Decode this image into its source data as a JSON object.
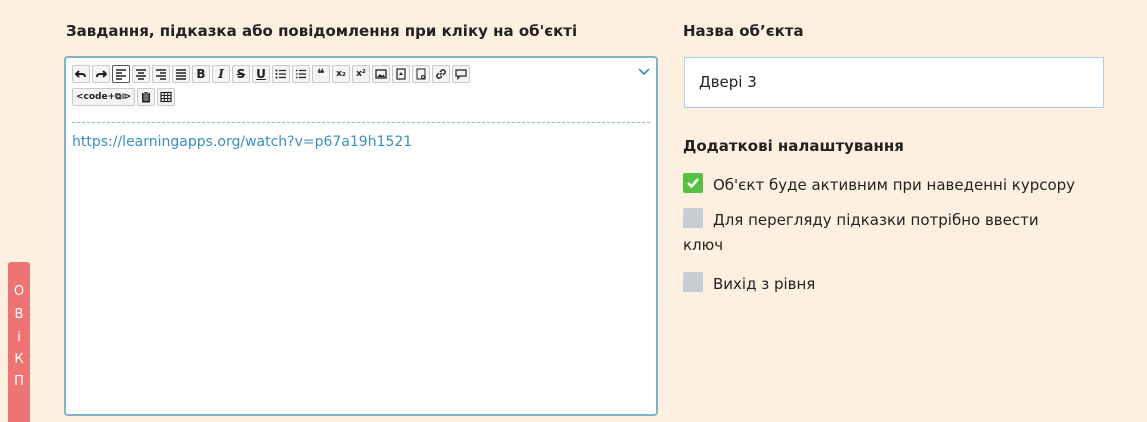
{
  "task": {
    "label": "Завдання, підказка або повідомлення при кліку на об'єкті",
    "content_link": "https://learningapps.org/watch?v=p67a19h1521",
    "toolbar": {
      "row1": [
        {
          "name": "undo-icon",
          "glyph": "↶"
        },
        {
          "name": "redo-icon",
          "glyph": "↷"
        },
        {
          "name": "align-left-icon",
          "glyph": "",
          "active": true
        },
        {
          "name": "align-center-icon",
          "glyph": ""
        },
        {
          "name": "align-right-icon",
          "glyph": ""
        },
        {
          "name": "align-justify-icon",
          "glyph": ""
        },
        {
          "name": "bold-icon",
          "glyph": "B"
        },
        {
          "name": "italic-icon",
          "glyph": "I"
        },
        {
          "name": "strikethrough-icon",
          "glyph": "S"
        },
        {
          "name": "underline-icon",
          "glyph": "U"
        },
        {
          "name": "bullet-list-icon",
          "glyph": "☰"
        },
        {
          "name": "numbered-list-icon",
          "glyph": "☰"
        },
        {
          "name": "quote-icon",
          "glyph": "❝"
        },
        {
          "name": "subscript-icon",
          "glyph": "x₂"
        },
        {
          "name": "superscript-icon",
          "glyph": "x²"
        },
        {
          "name": "image-icon",
          "glyph": "▣"
        },
        {
          "name": "file-icon",
          "glyph": "▤"
        },
        {
          "name": "document-icon",
          "glyph": "▢"
        },
        {
          "name": "link-icon",
          "glyph": "∞"
        },
        {
          "name": "comment-icon",
          "glyph": "▭"
        }
      ],
      "row2": [
        {
          "name": "code-icon",
          "glyph": "<code+⧉⧐"
        },
        {
          "name": "clipboard-icon",
          "glyph": "▤"
        },
        {
          "name": "table-icon",
          "glyph": "⊞"
        }
      ]
    }
  },
  "object_name": {
    "label": "Назва об’єкта",
    "value": "Двері 3"
  },
  "extra": {
    "label": "Додаткові налаштування",
    "options": [
      {
        "label": "Об'єкт буде активним при наведенні курсору",
        "checked": true
      },
      {
        "label_line1": "Для перегляду підказки потрібно ввести",
        "label_line2": "ключ",
        "checked": false
      },
      {
        "label": "Вихід з рівня",
        "checked": false
      }
    ]
  },
  "side_tab": {
    "chars": [
      "О",
      "В",
      "і",
      "К",
      "П"
    ]
  },
  "colors": {
    "background": "#fdf0e1",
    "editor_border": "#7eb3c8",
    "link": "#3a8fc6",
    "checked": "#55c142",
    "unchecked": "#c8ced3",
    "side_tab": "#ee7373"
  }
}
